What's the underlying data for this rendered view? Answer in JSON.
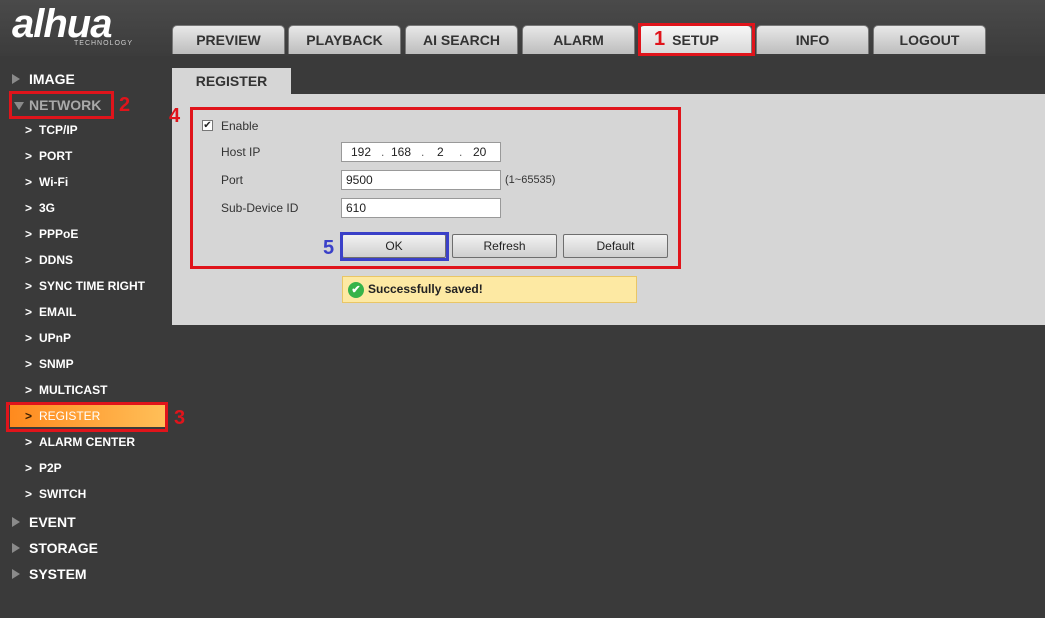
{
  "brand": {
    "logo": "alhua",
    "sub": "TECHNOLOGY"
  },
  "tabs": [
    {
      "label": "PREVIEW"
    },
    {
      "label": "PLAYBACK"
    },
    {
      "label": "AI SEARCH"
    },
    {
      "label": "ALARM"
    },
    {
      "label": "SETUP"
    },
    {
      "label": "INFO"
    },
    {
      "label": "LOGOUT"
    }
  ],
  "sidebar": {
    "sections": [
      {
        "label": "IMAGE"
      },
      {
        "label": "NETWORK"
      },
      {
        "label": "EVENT"
      },
      {
        "label": "STORAGE"
      },
      {
        "label": "SYSTEM"
      }
    ],
    "network_items": [
      {
        "label": "TCP/IP"
      },
      {
        "label": "PORT"
      },
      {
        "label": "Wi-Fi"
      },
      {
        "label": "3G"
      },
      {
        "label": "PPPoE"
      },
      {
        "label": "DDNS"
      },
      {
        "label": "SYNC TIME RIGHT"
      },
      {
        "label": "EMAIL"
      },
      {
        "label": "UPnP"
      },
      {
        "label": "SNMP"
      },
      {
        "label": "MULTICAST"
      },
      {
        "label": "REGISTER"
      },
      {
        "label": "ALARM CENTER"
      },
      {
        "label": "P2P"
      },
      {
        "label": "SWITCH"
      }
    ],
    "chevron": ">"
  },
  "content": {
    "tab_label": "REGISTER",
    "enable_label": "Enable",
    "enable_check": "✔",
    "host_ip_label": "Host IP",
    "host_ip": [
      "192",
      "168",
      "2",
      "20"
    ],
    "ip_dot": ".",
    "port_label": "Port",
    "port_value": "9500",
    "port_hint": "(1~65535)",
    "subdevice_label": "Sub-Device ID",
    "subdevice_value": "610",
    "buttons": {
      "ok": "OK",
      "refresh": "Refresh",
      "default": "Default"
    },
    "toast": {
      "icon": "✔",
      "message": "Successfully saved!"
    }
  },
  "annotations": [
    "1",
    "2",
    "3",
    "4",
    "5"
  ],
  "colors": {
    "marker_red": "#e0141b",
    "marker_blue": "#3a40c8",
    "active_item": "#ff8a1e",
    "toast_bg": "#fde9a3"
  }
}
